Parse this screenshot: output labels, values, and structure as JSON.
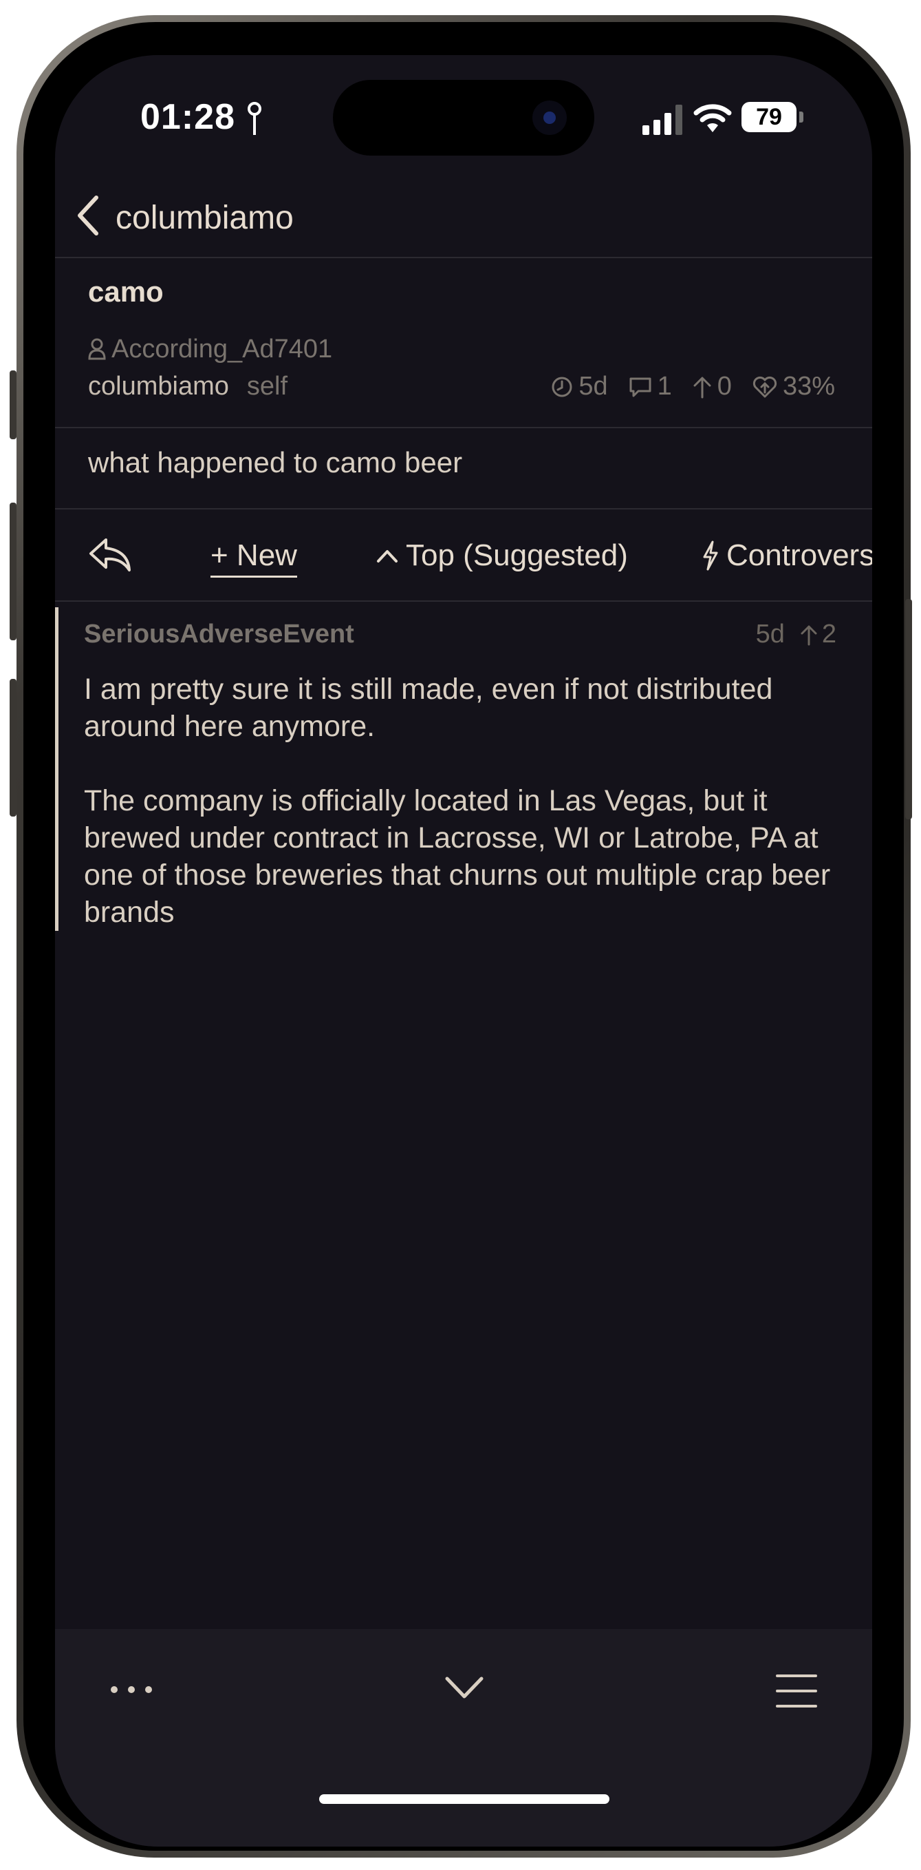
{
  "status_bar": {
    "time": "01:28",
    "battery": "79"
  },
  "nav": {
    "back_label": "columbiamo"
  },
  "post": {
    "title": "camo",
    "author": "According_Ad7401",
    "subreddit": "columbiamo",
    "type": "self",
    "age": "5d",
    "comments": "1",
    "score": "0",
    "upvote_ratio": "33%",
    "body": "what happened to camo beer"
  },
  "sort_bar": {
    "new_label": "+ New",
    "top_label": "Top (Suggested)",
    "controversial_label": "Controversial"
  },
  "comments": [
    {
      "author": "SeriousAdverseEvent",
      "age": "5d",
      "score": "2",
      "paragraphs": [
        "I am pretty sure it is still made, even if not distributed around here anymore.",
        "The company is officially located in Las Vegas, but it brewed under contract in Lacrosse, WI or Latrobe, PA at one of those breweries that churns out multiple crap beer brands"
      ]
    }
  ],
  "colors": {
    "background": "#14121a",
    "text": "#d9cfc2",
    "muted": "#7a746e",
    "toolbar": "#1c1a22"
  }
}
